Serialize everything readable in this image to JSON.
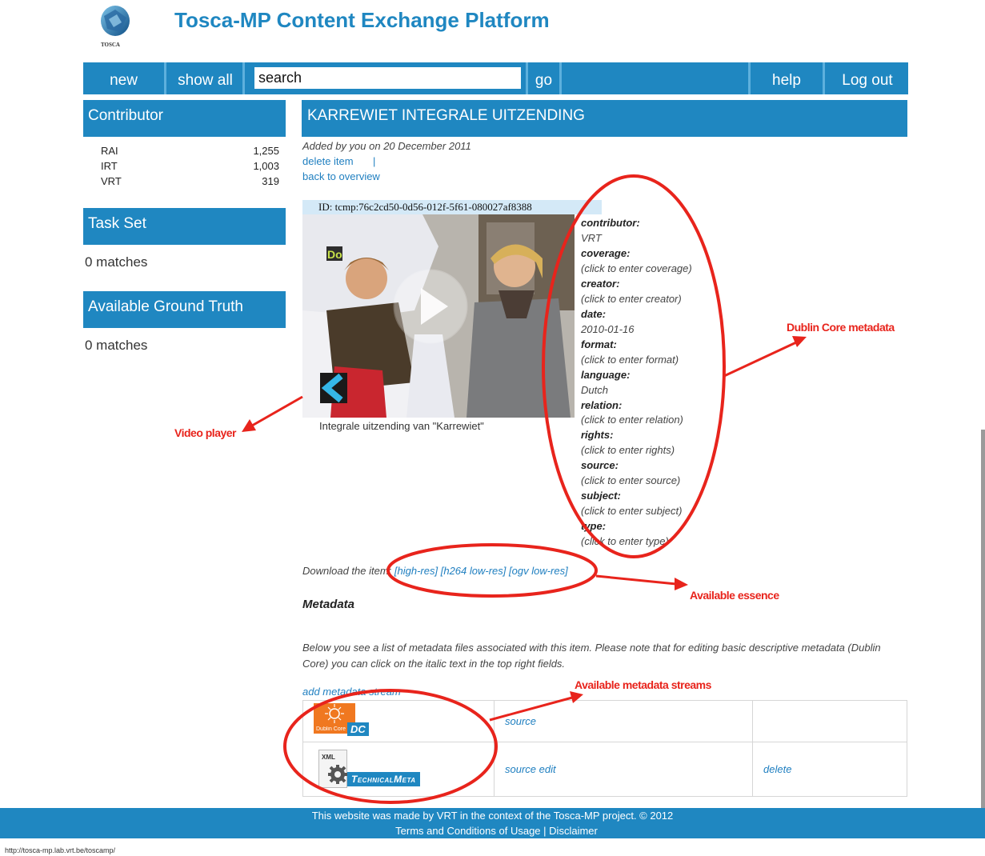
{
  "app": {
    "title": "Tosca-MP Content Exchange Platform",
    "logo_text": "TOSCA"
  },
  "nav": {
    "new": "new",
    "show_all": "show all",
    "search_value": "search",
    "go": "go",
    "help": "help",
    "logout": "Log out"
  },
  "sidebar": {
    "contributor": {
      "title": "Contributor",
      "items": [
        {
          "name": "RAI",
          "count": "1,255"
        },
        {
          "name": "IRT",
          "count": "1,003"
        },
        {
          "name": "VRT",
          "count": "319"
        }
      ]
    },
    "task_set": {
      "title": "Task Set",
      "matches": "0 matches"
    },
    "ground_truth": {
      "title": "Available Ground Truth",
      "matches": "0 matches"
    }
  },
  "item": {
    "title": "KARREWIET INTEGRALE UITZENDING",
    "added": "Added by you on 20 December 2011",
    "delete_link": "delete item",
    "separator": "|",
    "back_link": "back to overview",
    "id": "ID: tcmp:76c2cd50-0d56-012f-5f61-080027af8388",
    "caption": "Integrale uitzending van \"Karrewiet\"",
    "download_label": "Download the item:",
    "downloads": [
      "[high-res]",
      "[h264 low-res]",
      "[ogv low-res]"
    ]
  },
  "dublin_core": [
    {
      "label": "contributor:",
      "value": "VRT"
    },
    {
      "label": "coverage:",
      "value": "(click to enter coverage)"
    },
    {
      "label": "creator:",
      "value": "(click to enter creator)"
    },
    {
      "label": "date:",
      "value": "2010-01-16"
    },
    {
      "label": "format:",
      "value": "(click to enter format)"
    },
    {
      "label": "language:",
      "value": "Dutch"
    },
    {
      "label": "relation:",
      "value": "(click to enter relation)"
    },
    {
      "label": "rights:",
      "value": "(click to enter rights)"
    },
    {
      "label": "source:",
      "value": "(click to enter source)"
    },
    {
      "label": "subject:",
      "value": "(click to enter subject)"
    },
    {
      "label": "type:",
      "value": "(click to enter type)"
    }
  ],
  "metadata": {
    "heading": "Metadata",
    "description": "Below you see a list of metadata files associated with this item. Please note that for editing basic descriptive metadata (Dublin Core) you can click on the italic text in the top right fields.",
    "add_link": "add metadata stream",
    "streams": [
      {
        "badge": "DC",
        "icon_text": "Dublin Core",
        "actions": "source",
        "delete": ""
      },
      {
        "badge": "TechnicalMeta",
        "icon_text": "XML",
        "actions": "source edit",
        "delete": "delete"
      }
    ]
  },
  "annotations": {
    "dublin_core": "Dublin Core metadata",
    "video_player": "Video player",
    "essence": "Available essence",
    "streams": "Available metadata streams"
  },
  "footer": {
    "line1": "This website was made by VRT in the context of the Tosca-MP project. © 2012",
    "terms": "Terms and Conditions of Usage",
    "sep": "|",
    "disclaimer": "Disclaimer"
  },
  "status_url": "http://tosca-mp.lab.vrt.be/toscamp/",
  "colors": {
    "accent": "#1f87c1",
    "annotation": "#e8241c",
    "link": "#1f7fc0"
  }
}
